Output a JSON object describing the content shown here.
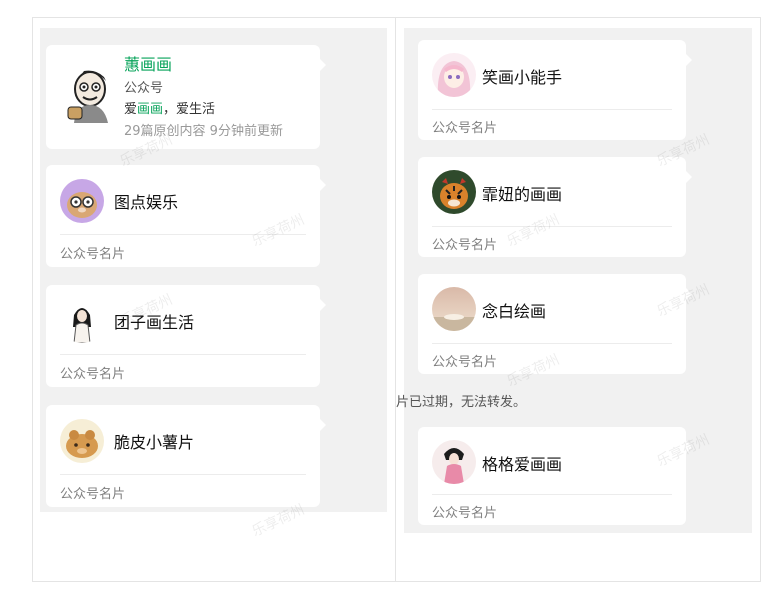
{
  "profile": {
    "name": "蕙画画",
    "type": "公众号",
    "desc_prefix": "爱",
    "desc_highlight": "画画",
    "desc_suffix": "，爱生活",
    "stats": "29篇原创内容  9分钟前更新"
  },
  "left_cards": [
    {
      "name": "图点娱乐",
      "footer": "公众号名片",
      "avatar_icon": "glasses-cartoon-avatar-icon"
    },
    {
      "name": "团子画生活",
      "footer": "公众号名片",
      "avatar_icon": "girl-sketch-avatar-icon"
    },
    {
      "name": "脆皮小薯片",
      "footer": "公众号名片",
      "avatar_icon": "capybara-avatar-icon"
    }
  ],
  "right_cards": [
    {
      "name": "笑画小能手",
      "footer": "公众号名片",
      "avatar_icon": "anime-girl-avatar-icon"
    },
    {
      "name": "霏妞的画画",
      "footer": "公众号名片",
      "avatar_icon": "tiger-avatar-icon"
    },
    {
      "name": "念白绘画",
      "footer": "公众号名片",
      "avatar_icon": "landscape-avatar-icon"
    },
    {
      "name": "格格爱画画",
      "footer": "公众号名片",
      "avatar_icon": "qing-lady-avatar-icon"
    }
  ],
  "expired_notice": "片已过期，无法转发。",
  "watermark": "乐享荷州",
  "colors": {
    "accent": "#07a35a",
    "panel_bg": "#f1f1f1",
    "card_bg": "#ffffff"
  }
}
